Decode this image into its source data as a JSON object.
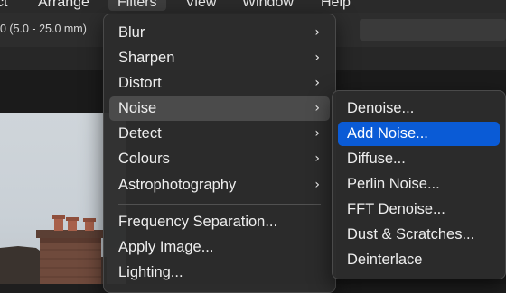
{
  "menubar": {
    "items": [
      "ct",
      "Arrange",
      "Filters",
      "View",
      "Window",
      "Help"
    ]
  },
  "toolbar": {
    "size_text": "0 (5.0 - 25.0 mm)"
  },
  "filters_menu": {
    "items": [
      {
        "label": "Blur",
        "submenu": true
      },
      {
        "label": "Sharpen",
        "submenu": true
      },
      {
        "label": "Distort",
        "submenu": true
      },
      {
        "label": "Noise",
        "submenu": true,
        "highlighted": true
      },
      {
        "label": "Detect",
        "submenu": true
      },
      {
        "label": "Colours",
        "submenu": true
      },
      {
        "label": "Astrophotography",
        "submenu": true
      },
      {
        "label": "Frequency Separation...",
        "submenu": false
      },
      {
        "label": "Apply Image...",
        "submenu": false
      },
      {
        "label": "Lighting...",
        "submenu": false
      }
    ],
    "chevron": "›"
  },
  "noise_menu": {
    "items": [
      {
        "label": "Denoise..."
      },
      {
        "label": "Add Noise...",
        "selected": true
      },
      {
        "label": "Diffuse..."
      },
      {
        "label": "Perlin Noise..."
      },
      {
        "label": "FFT Denoise..."
      },
      {
        "label": "Dust & Scratches..."
      },
      {
        "label": "Deinterlace"
      }
    ]
  },
  "colors": {
    "accent": "#0a5bd6",
    "menu_bg": "#2c2c2c",
    "hover": "#4b4b4b"
  }
}
